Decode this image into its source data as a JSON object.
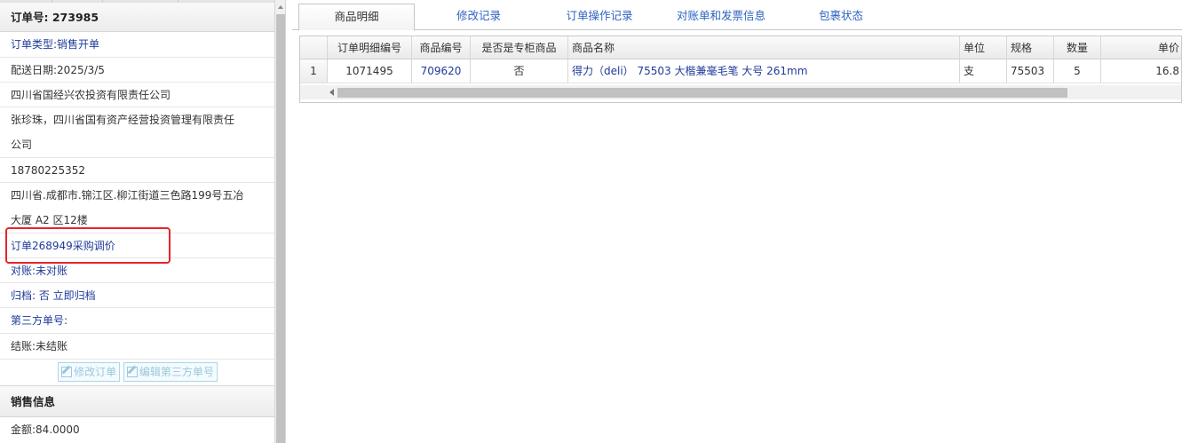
{
  "order": {
    "title_label": "订单号:",
    "title_number": "273985",
    "rows": [
      {
        "text": "订单类型:销售开单",
        "blue": true
      },
      {
        "text": "配送日期:2025/3/5",
        "blue": false
      },
      {
        "text": "四川省国经兴农投资有限责任公司",
        "blue": false
      },
      {
        "text_line1": "张珍珠，四川省国有资产经营投资管理有限责任",
        "text_line2": "公司",
        "blue": false
      },
      {
        "text": "18780225352",
        "blue": false
      },
      {
        "text_line1": "四川省.成都市.锦江区.柳江街道三色路199号五冶",
        "text_line2": "大厦 A2 区12楼",
        "blue": false
      },
      {
        "text": "订单268949采购调价",
        "blue": true
      },
      {
        "text": "对账:未对账",
        "blue": true
      },
      {
        "text": "归档: 否 立即归档",
        "blue": true
      },
      {
        "text": "第三方单号:",
        "blue": true
      },
      {
        "text": "结账:未结账",
        "blue": false
      }
    ],
    "edit_order_button": "修改订单",
    "edit_third_party_button": "编辑第三方单号"
  },
  "sales": {
    "header": "销售信息",
    "amount": "金额:84.0000"
  },
  "tabs": [
    {
      "label": "商品明细",
      "active": true
    },
    {
      "label": "修改记录",
      "active": false
    },
    {
      "label": "订单操作记录",
      "active": false
    },
    {
      "label": "对账单和发票信息",
      "active": false
    },
    {
      "label": "包裹状态",
      "active": false
    }
  ],
  "grid": {
    "columns": [
      "订单明细编号",
      "商品编号",
      "是否是专柜商品",
      "商品名称",
      "单位",
      "规格",
      "数量",
      "单价"
    ],
    "rows": [
      {
        "rownum": "1",
        "detail_id": "1071495",
        "product_code": "709620",
        "is_counter": "否",
        "name": "得力（deli） 75503 大楷兼毫毛笔 大号 261mm",
        "unit": "支",
        "spec": "75503",
        "qty": "5",
        "price": "16.8"
      }
    ]
  },
  "colors": {
    "link": "#1f3a9a",
    "tab_text": "#2d62c0",
    "highlight": "#e8242a"
  }
}
